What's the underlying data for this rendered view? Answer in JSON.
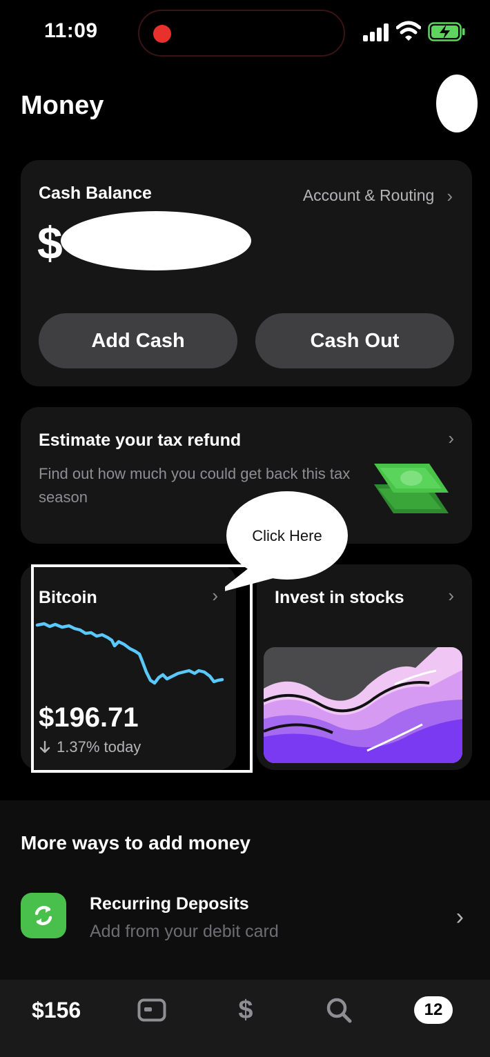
{
  "status_bar": {
    "time": "11:09"
  },
  "header": {
    "title": "Money"
  },
  "balance_card": {
    "label": "Cash Balance",
    "account_routing": "Account & Routing",
    "currency_symbol": "$",
    "add_cash_label": "Add Cash",
    "cash_out_label": "Cash Out"
  },
  "tax_card": {
    "title": "Estimate your tax refund",
    "description": "Find out how much you could get back this tax season"
  },
  "callout": {
    "text": "Click Here"
  },
  "bitcoin_card": {
    "title": "Bitcoin",
    "price": "$196.71",
    "change": "1.37% today",
    "line_color": "#5ac8fa"
  },
  "stocks_card": {
    "title": "Invest in stocks"
  },
  "more_ways": {
    "title": "More ways to add money",
    "recurring": {
      "title": "Recurring Deposits",
      "subtitle": "Add from your debit card",
      "icon_color": "#48c04b"
    }
  },
  "tab_bar": {
    "money_label": "$156",
    "activity_badge": "12"
  }
}
